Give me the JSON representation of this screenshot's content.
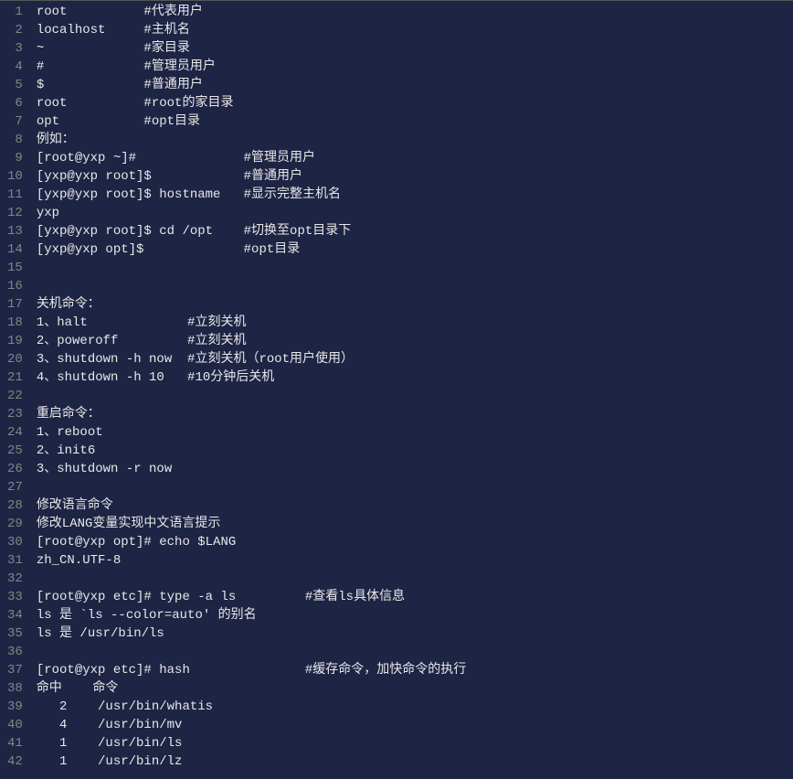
{
  "lines": [
    "root          #代表用户",
    "localhost     #主机名",
    "~             #家目录",
    "#             #管理员用户",
    "$             #普通用户",
    "root          #root的家目录",
    "opt           #opt目录",
    "例如：",
    "[root@yxp ~]#              #管理员用户",
    "[yxp@yxp root]$            #普通用户",
    "[yxp@yxp root]$ hostname   #显示完整主机名",
    "yxp",
    "[yxp@yxp root]$ cd /opt    #切换至opt目录下",
    "[yxp@yxp opt]$             #opt目录",
    "",
    "",
    "关机命令：",
    "1、halt             #立刻关机",
    "2、poweroff         #立刻关机",
    "3、shutdown -h now  #立刻关机（root用户使用）",
    "4、shutdown -h 10   #10分钟后关机",
    "",
    "重启命令：",
    "1、reboot",
    "2、init6",
    "3、shutdown -r now",
    "",
    "修改语言命令",
    "修改LANG变量实现中文语言提示",
    "[root@yxp opt]# echo $LANG",
    "zh_CN.UTF-8",
    "",
    "[root@yxp etc]# type -a ls         #查看ls具体信息",
    "ls 是 `ls --color=auto' 的别名",
    "ls 是 /usr/bin/ls",
    "",
    "[root@yxp etc]# hash               #缓存命令，加快命令的执行",
    "命中    命令",
    "   2    /usr/bin/whatis",
    "   4    /usr/bin/mv",
    "   1    /usr/bin/ls",
    "   1    /usr/bin/lz"
  ]
}
